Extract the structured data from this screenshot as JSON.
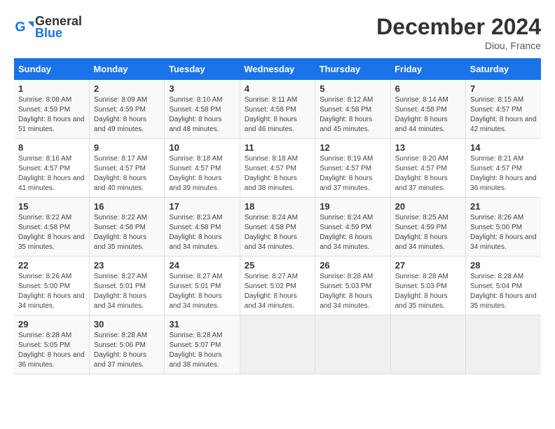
{
  "header": {
    "logo_general": "General",
    "logo_blue": "Blue",
    "title": "December 2024",
    "location": "Diou, France"
  },
  "columns": [
    "Sunday",
    "Monday",
    "Tuesday",
    "Wednesday",
    "Thursday",
    "Friday",
    "Saturday"
  ],
  "weeks": [
    [
      {
        "day": "1",
        "sunrise": "8:08 AM",
        "sunset": "4:59 PM",
        "daylight": "8 hours and 51 minutes."
      },
      {
        "day": "2",
        "sunrise": "8:09 AM",
        "sunset": "4:59 PM",
        "daylight": "8 hours and 49 minutes."
      },
      {
        "day": "3",
        "sunrise": "8:10 AM",
        "sunset": "4:58 PM",
        "daylight": "8 hours and 48 minutes."
      },
      {
        "day": "4",
        "sunrise": "8:11 AM",
        "sunset": "4:58 PM",
        "daylight": "8 hours and 46 minutes."
      },
      {
        "day": "5",
        "sunrise": "8:12 AM",
        "sunset": "4:58 PM",
        "daylight": "8 hours and 45 minutes."
      },
      {
        "day": "6",
        "sunrise": "8:14 AM",
        "sunset": "4:58 PM",
        "daylight": "8 hours and 44 minutes."
      },
      {
        "day": "7",
        "sunrise": "8:15 AM",
        "sunset": "4:57 PM",
        "daylight": "8 hours and 42 minutes."
      }
    ],
    [
      {
        "day": "8",
        "sunrise": "8:16 AM",
        "sunset": "4:57 PM",
        "daylight": "8 hours and 41 minutes."
      },
      {
        "day": "9",
        "sunrise": "8:17 AM",
        "sunset": "4:57 PM",
        "daylight": "8 hours and 40 minutes."
      },
      {
        "day": "10",
        "sunrise": "8:18 AM",
        "sunset": "4:57 PM",
        "daylight": "8 hours and 39 minutes."
      },
      {
        "day": "11",
        "sunrise": "8:18 AM",
        "sunset": "4:57 PM",
        "daylight": "8 hours and 38 minutes."
      },
      {
        "day": "12",
        "sunrise": "8:19 AM",
        "sunset": "4:57 PM",
        "daylight": "8 hours and 37 minutes."
      },
      {
        "day": "13",
        "sunrise": "8:20 AM",
        "sunset": "4:57 PM",
        "daylight": "8 hours and 37 minutes."
      },
      {
        "day": "14",
        "sunrise": "8:21 AM",
        "sunset": "4:57 PM",
        "daylight": "8 hours and 36 minutes."
      }
    ],
    [
      {
        "day": "15",
        "sunrise": "8:22 AM",
        "sunset": "4:58 PM",
        "daylight": "8 hours and 35 minutes."
      },
      {
        "day": "16",
        "sunrise": "8:22 AM",
        "sunset": "4:58 PM",
        "daylight": "8 hours and 35 minutes."
      },
      {
        "day": "17",
        "sunrise": "8:23 AM",
        "sunset": "4:58 PM",
        "daylight": "8 hours and 34 minutes."
      },
      {
        "day": "18",
        "sunrise": "8:24 AM",
        "sunset": "4:58 PM",
        "daylight": "8 hours and 34 minutes."
      },
      {
        "day": "19",
        "sunrise": "8:24 AM",
        "sunset": "4:59 PM",
        "daylight": "8 hours and 34 minutes."
      },
      {
        "day": "20",
        "sunrise": "8:25 AM",
        "sunset": "4:59 PM",
        "daylight": "8 hours and 34 minutes."
      },
      {
        "day": "21",
        "sunrise": "8:26 AM",
        "sunset": "5:00 PM",
        "daylight": "8 hours and 34 minutes."
      }
    ],
    [
      {
        "day": "22",
        "sunrise": "8:26 AM",
        "sunset": "5:00 PM",
        "daylight": "8 hours and 34 minutes."
      },
      {
        "day": "23",
        "sunrise": "8:27 AM",
        "sunset": "5:01 PM",
        "daylight": "8 hours and 34 minutes."
      },
      {
        "day": "24",
        "sunrise": "8:27 AM",
        "sunset": "5:01 PM",
        "daylight": "8 hours and 34 minutes."
      },
      {
        "day": "25",
        "sunrise": "8:27 AM",
        "sunset": "5:02 PM",
        "daylight": "8 hours and 34 minutes."
      },
      {
        "day": "26",
        "sunrise": "8:28 AM",
        "sunset": "5:03 PM",
        "daylight": "8 hours and 34 minutes."
      },
      {
        "day": "27",
        "sunrise": "8:28 AM",
        "sunset": "5:03 PM",
        "daylight": "8 hours and 35 minutes."
      },
      {
        "day": "28",
        "sunrise": "8:28 AM",
        "sunset": "5:04 PM",
        "daylight": "8 hours and 35 minutes."
      }
    ],
    [
      {
        "day": "29",
        "sunrise": "8:28 AM",
        "sunset": "5:05 PM",
        "daylight": "8 hours and 36 minutes."
      },
      {
        "day": "30",
        "sunrise": "8:28 AM",
        "sunset": "5:06 PM",
        "daylight": "8 hours and 37 minutes."
      },
      {
        "day": "31",
        "sunrise": "8:28 AM",
        "sunset": "5:07 PM",
        "daylight": "8 hours and 38 minutes."
      },
      null,
      null,
      null,
      null
    ]
  ]
}
